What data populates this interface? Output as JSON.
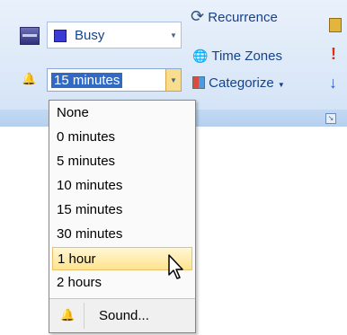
{
  "showas": {
    "value": "Busy"
  },
  "reminder": {
    "value": "15 minutes"
  },
  "commands": {
    "recurrence": "Recurrence",
    "timezones": "Time Zones",
    "categorize": "Categorize"
  },
  "dropdown": {
    "items": [
      "None",
      "0 minutes",
      "5 minutes",
      "10 minutes",
      "15 minutes",
      "30 minutes",
      "1 hour",
      "2 hours"
    ],
    "hovered": "1 hour",
    "sound_label": "Sound..."
  }
}
